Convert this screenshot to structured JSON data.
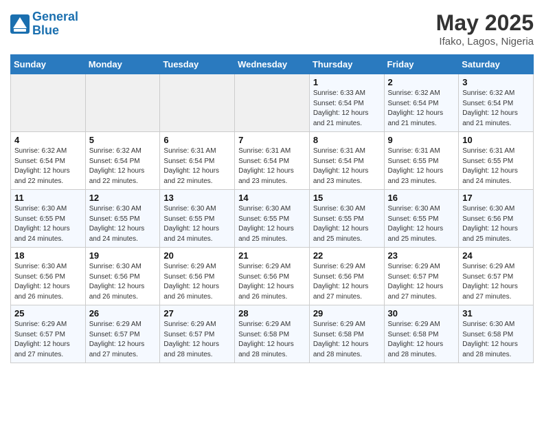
{
  "header": {
    "logo_line1": "General",
    "logo_line2": "Blue",
    "month_year": "May 2025",
    "location": "Ifako, Lagos, Nigeria"
  },
  "weekdays": [
    "Sunday",
    "Monday",
    "Tuesday",
    "Wednesday",
    "Thursday",
    "Friday",
    "Saturday"
  ],
  "weeks": [
    [
      {
        "day": "",
        "info": ""
      },
      {
        "day": "",
        "info": ""
      },
      {
        "day": "",
        "info": ""
      },
      {
        "day": "",
        "info": ""
      },
      {
        "day": "1",
        "info": "Sunrise: 6:33 AM\nSunset: 6:54 PM\nDaylight: 12 hours\nand 21 minutes."
      },
      {
        "day": "2",
        "info": "Sunrise: 6:32 AM\nSunset: 6:54 PM\nDaylight: 12 hours\nand 21 minutes."
      },
      {
        "day": "3",
        "info": "Sunrise: 6:32 AM\nSunset: 6:54 PM\nDaylight: 12 hours\nand 21 minutes."
      }
    ],
    [
      {
        "day": "4",
        "info": "Sunrise: 6:32 AM\nSunset: 6:54 PM\nDaylight: 12 hours\nand 22 minutes."
      },
      {
        "day": "5",
        "info": "Sunrise: 6:32 AM\nSunset: 6:54 PM\nDaylight: 12 hours\nand 22 minutes."
      },
      {
        "day": "6",
        "info": "Sunrise: 6:31 AM\nSunset: 6:54 PM\nDaylight: 12 hours\nand 22 minutes."
      },
      {
        "day": "7",
        "info": "Sunrise: 6:31 AM\nSunset: 6:54 PM\nDaylight: 12 hours\nand 23 minutes."
      },
      {
        "day": "8",
        "info": "Sunrise: 6:31 AM\nSunset: 6:54 PM\nDaylight: 12 hours\nand 23 minutes."
      },
      {
        "day": "9",
        "info": "Sunrise: 6:31 AM\nSunset: 6:55 PM\nDaylight: 12 hours\nand 23 minutes."
      },
      {
        "day": "10",
        "info": "Sunrise: 6:31 AM\nSunset: 6:55 PM\nDaylight: 12 hours\nand 24 minutes."
      }
    ],
    [
      {
        "day": "11",
        "info": "Sunrise: 6:30 AM\nSunset: 6:55 PM\nDaylight: 12 hours\nand 24 minutes."
      },
      {
        "day": "12",
        "info": "Sunrise: 6:30 AM\nSunset: 6:55 PM\nDaylight: 12 hours\nand 24 minutes."
      },
      {
        "day": "13",
        "info": "Sunrise: 6:30 AM\nSunset: 6:55 PM\nDaylight: 12 hours\nand 24 minutes."
      },
      {
        "day": "14",
        "info": "Sunrise: 6:30 AM\nSunset: 6:55 PM\nDaylight: 12 hours\nand 25 minutes."
      },
      {
        "day": "15",
        "info": "Sunrise: 6:30 AM\nSunset: 6:55 PM\nDaylight: 12 hours\nand 25 minutes."
      },
      {
        "day": "16",
        "info": "Sunrise: 6:30 AM\nSunset: 6:55 PM\nDaylight: 12 hours\nand 25 minutes."
      },
      {
        "day": "17",
        "info": "Sunrise: 6:30 AM\nSunset: 6:56 PM\nDaylight: 12 hours\nand 25 minutes."
      }
    ],
    [
      {
        "day": "18",
        "info": "Sunrise: 6:30 AM\nSunset: 6:56 PM\nDaylight: 12 hours\nand 26 minutes."
      },
      {
        "day": "19",
        "info": "Sunrise: 6:30 AM\nSunset: 6:56 PM\nDaylight: 12 hours\nand 26 minutes."
      },
      {
        "day": "20",
        "info": "Sunrise: 6:29 AM\nSunset: 6:56 PM\nDaylight: 12 hours\nand 26 minutes."
      },
      {
        "day": "21",
        "info": "Sunrise: 6:29 AM\nSunset: 6:56 PM\nDaylight: 12 hours\nand 26 minutes."
      },
      {
        "day": "22",
        "info": "Sunrise: 6:29 AM\nSunset: 6:56 PM\nDaylight: 12 hours\nand 27 minutes."
      },
      {
        "day": "23",
        "info": "Sunrise: 6:29 AM\nSunset: 6:57 PM\nDaylight: 12 hours\nand 27 minutes."
      },
      {
        "day": "24",
        "info": "Sunrise: 6:29 AM\nSunset: 6:57 PM\nDaylight: 12 hours\nand 27 minutes."
      }
    ],
    [
      {
        "day": "25",
        "info": "Sunrise: 6:29 AM\nSunset: 6:57 PM\nDaylight: 12 hours\nand 27 minutes."
      },
      {
        "day": "26",
        "info": "Sunrise: 6:29 AM\nSunset: 6:57 PM\nDaylight: 12 hours\nand 27 minutes."
      },
      {
        "day": "27",
        "info": "Sunrise: 6:29 AM\nSunset: 6:57 PM\nDaylight: 12 hours\nand 28 minutes."
      },
      {
        "day": "28",
        "info": "Sunrise: 6:29 AM\nSunset: 6:58 PM\nDaylight: 12 hours\nand 28 minutes."
      },
      {
        "day": "29",
        "info": "Sunrise: 6:29 AM\nSunset: 6:58 PM\nDaylight: 12 hours\nand 28 minutes."
      },
      {
        "day": "30",
        "info": "Sunrise: 6:29 AM\nSunset: 6:58 PM\nDaylight: 12 hours\nand 28 minutes."
      },
      {
        "day": "31",
        "info": "Sunrise: 6:30 AM\nSunset: 6:58 PM\nDaylight: 12 hours\nand 28 minutes."
      }
    ]
  ]
}
